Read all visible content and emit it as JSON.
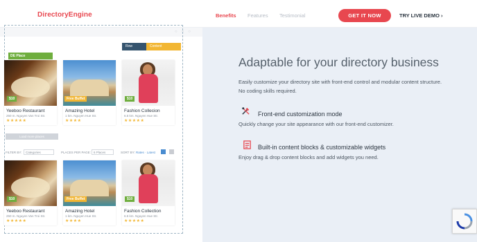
{
  "header": {
    "logo": "DirectoryEngine",
    "nav": [
      "Benefits",
      "Features",
      "Testimonial"
    ],
    "cta_label": "GET IT NOW",
    "demo_label": "TRY LIVE DEMO ›"
  },
  "editor": {
    "toolbar": [
      "Row",
      "Content"
    ],
    "place_tag": "DE Place",
    "load_more": "Load more places",
    "filters": {
      "filter_by": "FILTER BY:",
      "filter_value": "Categories",
      "per_page": "PLACES PER PAGE:",
      "per_page_value": "6 Places",
      "sort_by": "SORT BY:",
      "sort_value": "Rates · Latest"
    }
  },
  "cards_top": [
    {
      "title": "Yeeboo Restaurant",
      "addr": "250 m. Nguyen Van Troi Str.",
      "stars": "★★★★★",
      "tag": "$10",
      "image": "food"
    },
    {
      "title": "Amazing Hotel",
      "addr": "1 km. Nguyen Hue Str.",
      "stars": "★★★★",
      "tag": "Free Buffet",
      "image": "hotel"
    },
    {
      "title": "Fashion Collecion",
      "addr": "6.5 km. Nguyen Hue Str.",
      "stars": "★★★★★",
      "tag": "$10",
      "image": "fashion"
    }
  ],
  "cards_bottom": [
    {
      "title": "Yeeboo Restaurant",
      "addr": "250 m. Nguyen Van Troi Str.",
      "stars": "★★★★★",
      "tag": "$10",
      "image": "food"
    },
    {
      "title": "Amazing Hotel",
      "addr": "1 km. Nguyen Hue Str.",
      "stars": "★★★★",
      "tag": "Free Buffet",
      "image": "hotel"
    },
    {
      "title": "Fashion Collection",
      "addr": "6.5 km. Nguyen Hue Str.",
      "stars": "★★★★★",
      "tag": "$10",
      "image": "fashion"
    }
  ],
  "hero": {
    "headline": "Adaptable for your directory business",
    "description": "Easily customize your directory site with front-end control and modular content structure. No coding skills required.",
    "features": [
      {
        "icon": "tools-icon",
        "title": "Front-end customization mode",
        "desc": "Quickly change your site appearance with our front-end customizer."
      },
      {
        "icon": "blocks-icon",
        "title": "Built-in content blocks & customizable widgets",
        "desc": "Enjoy drag & drop content blocks and add widgets you need."
      }
    ]
  },
  "colors": {
    "accent": "#e8474f",
    "panel_bg": "#eaeff6",
    "star": "#f2b632",
    "tag_green": "#6fae3e"
  }
}
